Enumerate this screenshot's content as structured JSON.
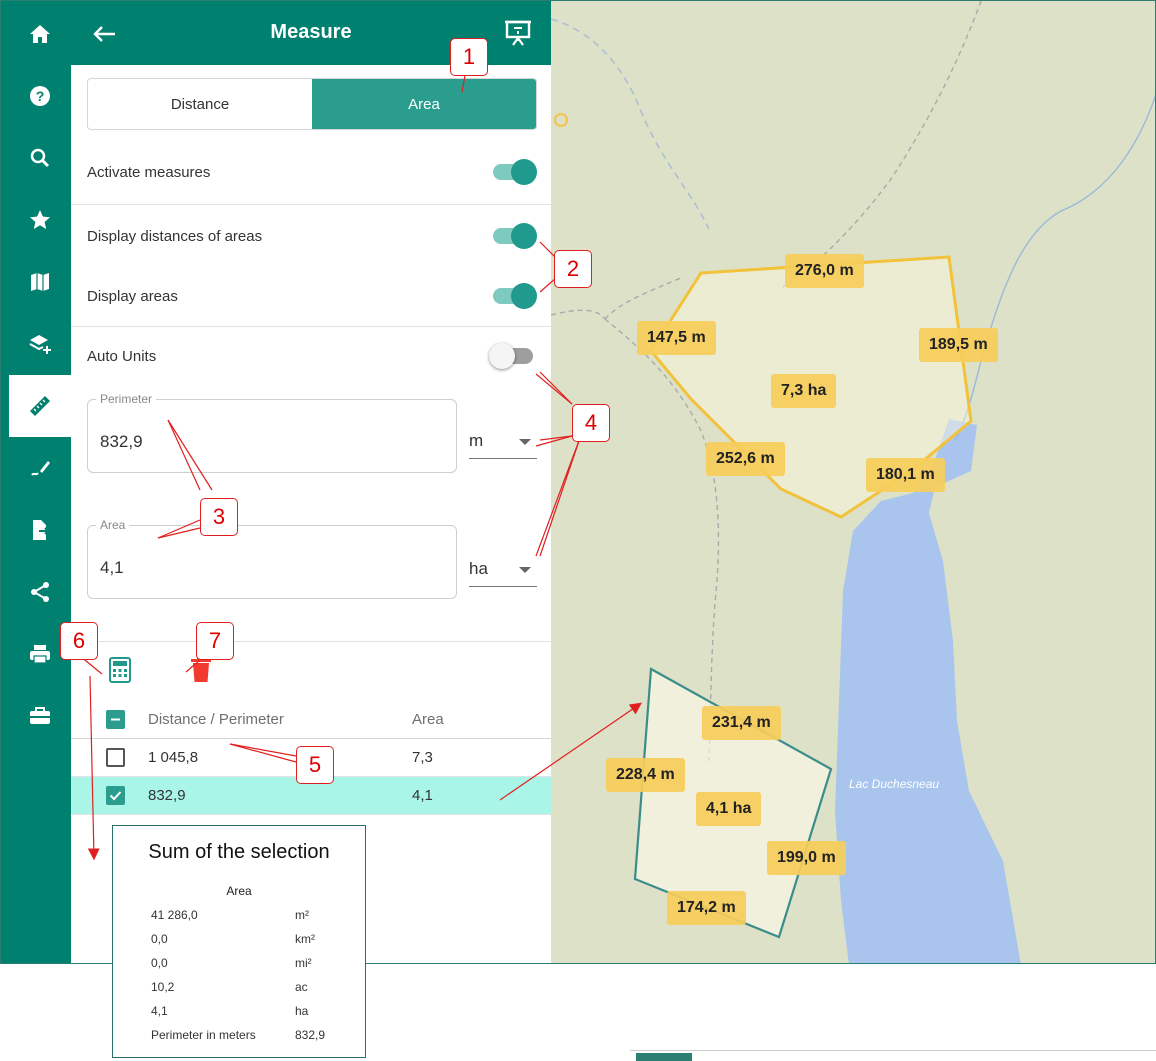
{
  "panel": {
    "title": "Measure",
    "tabs": [
      {
        "label": "Distance",
        "active": false
      },
      {
        "label": "Area",
        "active": true
      }
    ],
    "toggles": {
      "activate_measures": {
        "label": "Activate measures",
        "on": true
      },
      "display_distances": {
        "label": "Display distances of areas",
        "on": true
      },
      "display_areas": {
        "label": "Display areas",
        "on": true
      },
      "auto_units": {
        "label": "Auto Units",
        "on": false
      }
    },
    "perimeter": {
      "label": "Perimeter",
      "value": "832,9",
      "unit": "m"
    },
    "area": {
      "label": "Area",
      "value": "4,1",
      "unit": "ha"
    },
    "table": {
      "headers": [
        "Distance / Perimeter",
        "Area"
      ],
      "rows": [
        {
          "perimeter": "1 045,8",
          "area": "7,3",
          "checked": false
        },
        {
          "perimeter": "832,9",
          "area": "4,1",
          "checked": true
        }
      ]
    }
  },
  "rail": {
    "items": [
      "home-icon",
      "help-icon",
      "search-icon",
      "favorites-icon",
      "map-icon",
      "add-layer-icon",
      "measure-icon",
      "draw-icon",
      "export-icon",
      "share-icon",
      "print-icon",
      "toolbox-icon"
    ],
    "active": "measure-icon"
  },
  "map": {
    "lake_name": "Lac Duchesneau",
    "polygon1_labels": {
      "top": "276,0 m",
      "left": "147,5 m",
      "right": "189,5 m",
      "center": "7,3 ha",
      "bottom_left": "252,6 m",
      "bottom_right": "180,1 m"
    },
    "polygon2_labels": {
      "top": "231,4 m",
      "left": "228,4 m",
      "center": "4,1 ha",
      "right": "199,0 m",
      "bottom": "174,2 m"
    }
  },
  "sum_popup": {
    "title": "Sum of the selection",
    "header": "Area",
    "rows": [
      {
        "value": "41 286,0",
        "unit": "m²"
      },
      {
        "value": "0,0",
        "unit": "km²"
      },
      {
        "value": "0,0",
        "unit": "mi²"
      },
      {
        "value": "10,2",
        "unit": "ac"
      },
      {
        "value": "4,1",
        "unit": "ha"
      },
      {
        "value": "Perimeter in meters",
        "unit": "832,9"
      }
    ]
  },
  "annotations": [
    "1",
    "2",
    "3",
    "4",
    "5",
    "6",
    "7"
  ],
  "colors": {
    "brand": "#00806f",
    "toggle_on": "#1f9a8c",
    "selected_row": "#a9f6e8",
    "label_fill": "#f7cd5a",
    "polygon_yellow": "#f2c23a",
    "polygon_teal": "#3a8d88",
    "lake": "#a9c5ee",
    "map_bg": "#dde1c8",
    "annotation_red": "#e02020"
  }
}
